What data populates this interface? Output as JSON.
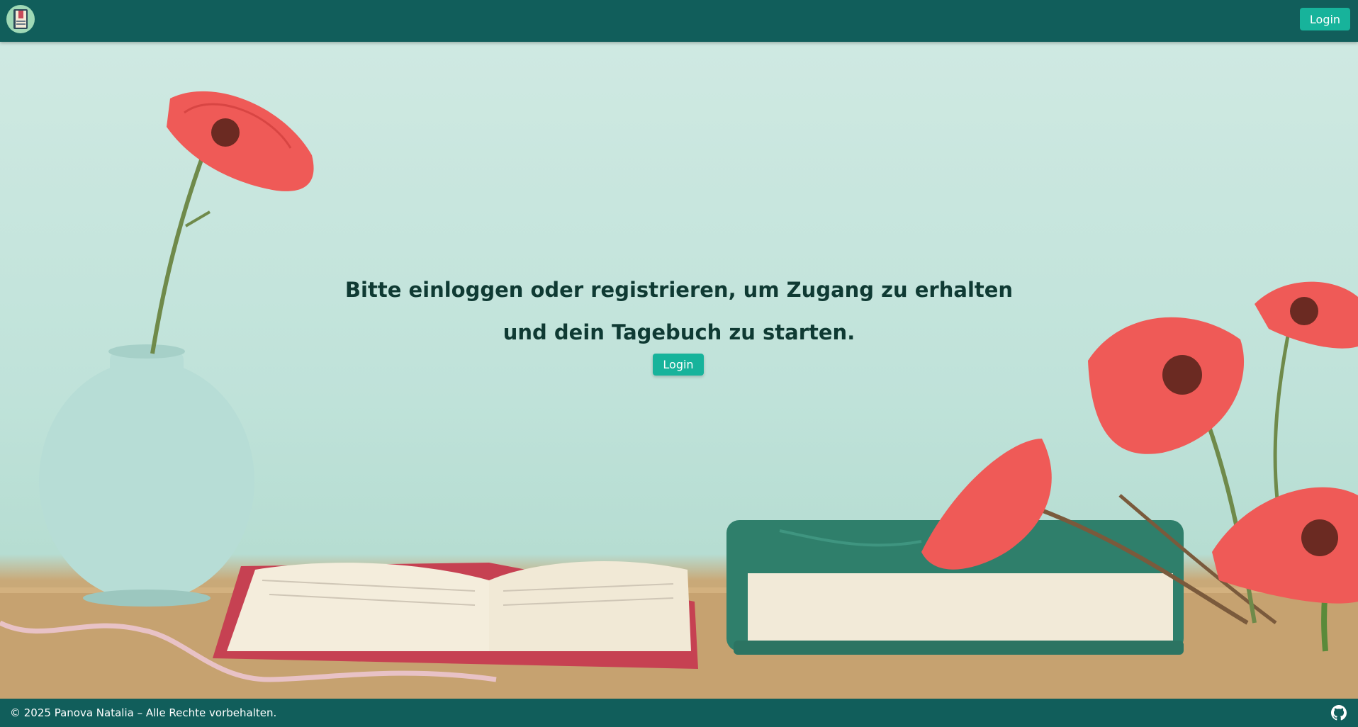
{
  "header": {
    "logo_icon": "diary-book-icon",
    "login_label": "Login"
  },
  "hero": {
    "message": "Bitte einloggen oder registrieren, um Zugang zu erhalten und dein Tagebuch zu starten.",
    "login_label": "Login",
    "background_image": "vase-poppies-books-illustration"
  },
  "footer": {
    "copyright": "© 2025 Panova Natalia – Alle Rechte vorbehalten.",
    "github_icon": "github-icon"
  },
  "colors": {
    "nav_background": "#115e5b",
    "button_accent": "#17b39b",
    "hero_text": "#0f3a33"
  }
}
